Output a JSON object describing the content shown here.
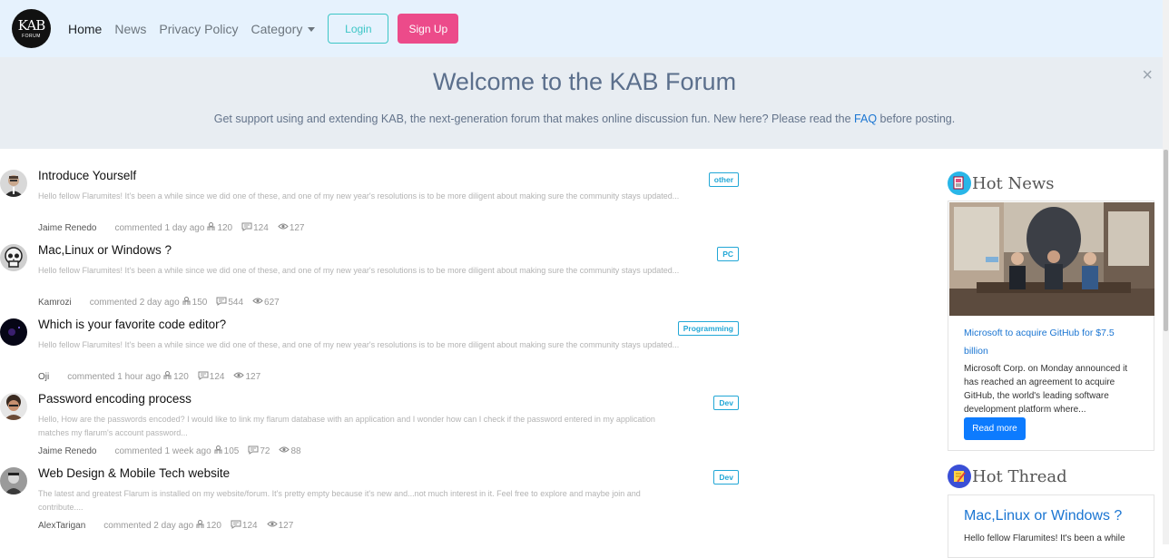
{
  "nav": {
    "logo_main": "KAB",
    "logo_sub": "FORUM",
    "links": [
      "Home",
      "News",
      "Privacy Policy",
      "Category"
    ],
    "login": "Login",
    "signup": "Sign Up"
  },
  "hero": {
    "title": "Welcome to the KAB Forum",
    "text_before": "Get support using and extending KAB, the next-generation forum that makes online discussion fun. New here? Please read the ",
    "faq": "FAQ",
    "text_after": " before posting.",
    "close": "×"
  },
  "discussions": [
    {
      "title": "Introduce Yourself",
      "excerpt": "Hello fellow Flarumites! It's been a while since we did one of these, and one of my new year's resolutions is to be more diligent about making sure the community stays updated...",
      "author": "Jaime Renedo",
      "when": "commented 1 day ago",
      "likes": "120",
      "comments": "124",
      "views": "127",
      "tag": "other",
      "avatar": "man-portrait"
    },
    {
      "title": "Mac,Linux or Windows ?",
      "excerpt": "Hello fellow Flarumites! It's been a while since we did one of these, and one of my new year's resolutions is to be more diligent about making sure the community stays updated...",
      "author": "Kamrozi",
      "when": "commented 2 day ago",
      "likes": "150",
      "comments": "544",
      "views": "627",
      "tag": "PC",
      "avatar": "skull"
    },
    {
      "title": "Which is your favorite code editor?",
      "excerpt": "Hello fellow Flarumites! It's been a while since we did one of these, and one of my new year's resolutions is to be more diligent about making sure the community stays updated...",
      "author": "Oji",
      "when": "commented 1 hour ago",
      "likes": "120",
      "comments": "124",
      "views": "127",
      "tag": "Programming",
      "avatar": "dark-space"
    },
    {
      "title": "Password encoding process",
      "excerpt": "Hello, How are the passwords encoded? I would like to link my flarum database with an application and I wonder how can I check if the password entered in my application matches my flarum's account password...",
      "author": "Jaime Renedo",
      "when": "commented 1 week ago",
      "likes": "105",
      "comments": "72",
      "views": "88",
      "tag": "Dev",
      "avatar": "curly-man"
    },
    {
      "title": "Web Design & Mobile Tech website",
      "excerpt": "The latest and greatest Flarum is installed on my website/forum. It's pretty empty because it's new and...not much interest in it. Feel free to explore and maybe join and contribute....",
      "author": "AlexTarigan",
      "when": "commented 2 day ago",
      "likes": "120",
      "comments": "124",
      "views": "127",
      "tag": "Dev",
      "avatar": "bw-man"
    }
  ],
  "sidebar": {
    "hot_news_title": "Hot News",
    "news_link": "Microsoft to acquire GitHub for $7.5 billion",
    "news_body": "Microsoft Corp. on Monday announced it has reached an agreement to acquire GitHub, the world's leading software development platform where...",
    "read_more": "Read more",
    "hot_thread_title": "Hot Thread",
    "thread_title": "Mac,Linux or Windows ?",
    "thread_body": "Hello fellow Flarumites! It's been a while"
  },
  "colors": {
    "navbar_bg": "#e6f2fd",
    "hero_bg": "#e8edf2",
    "accent_teal": "#3cc6c6",
    "accent_pink": "#ec4b8a",
    "link_blue": "#1a75d2",
    "tag_blue": "#22a7d6",
    "button_blue": "#0d7bfe"
  },
  "icons": [
    "like-icon",
    "comment-icon",
    "eye-icon",
    "hot-news-icon",
    "hot-thread-icon"
  ]
}
